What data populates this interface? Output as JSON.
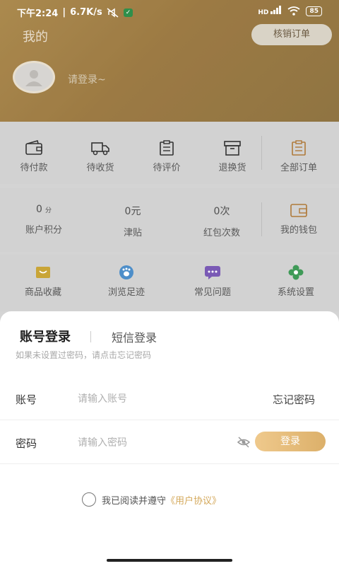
{
  "status_bar": {
    "time": "下午2:24",
    "speed": "6.7K/s",
    "battery": "85",
    "network": "HD"
  },
  "header": {
    "title": "我的",
    "verify_button": "核销订单",
    "login_prompt": "请登录~"
  },
  "orders": [
    {
      "label": "待付款",
      "icon": "wallet-icon"
    },
    {
      "label": "待收货",
      "icon": "truck-icon"
    },
    {
      "label": "待评价",
      "icon": "clipboard-icon"
    },
    {
      "label": "退换货",
      "icon": "box-icon"
    },
    {
      "label": "全部订单",
      "icon": "orders-icon"
    }
  ],
  "wallet": {
    "points": {
      "value": "0",
      "unit": "分",
      "label": "账户积分"
    },
    "allowance": {
      "value": "0元",
      "label": "津贴"
    },
    "red_packets": {
      "value": "0次",
      "label": "红包次数"
    },
    "my_wallet": {
      "label": "我的钱包",
      "icon": "wallet-icon"
    }
  },
  "tools": [
    {
      "label": "商品收藏",
      "icon": "favorite-box-icon"
    },
    {
      "label": "浏览足迹",
      "icon": "footprint-icon"
    },
    {
      "label": "常见问题",
      "icon": "chat-icon"
    },
    {
      "label": "系统设置",
      "icon": "flower-icon"
    }
  ],
  "login_sheet": {
    "tab_account": "账号登录",
    "tab_sms": "短信登录",
    "tip": "如果未设置过密码，请点击忘记密码",
    "account_label": "账号",
    "account_placeholder": "请输入账号",
    "forgot_password": "忘记密码",
    "password_label": "密码",
    "password_placeholder": "请输入密码",
    "login_button": "登录",
    "agree_text": "我已阅读并遵守",
    "agree_link": "《用户协议》"
  },
  "colors": {
    "accent": "#dcb06a",
    "link": "#d4a85a"
  }
}
